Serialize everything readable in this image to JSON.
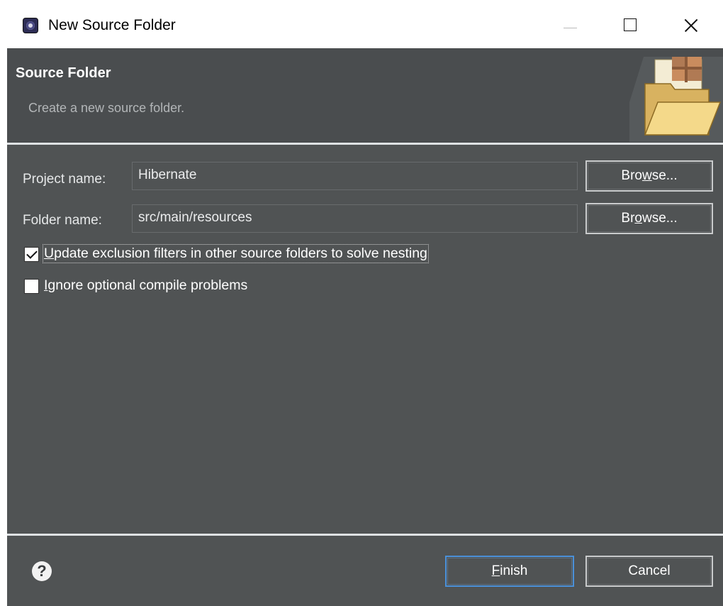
{
  "window": {
    "title": "New Source Folder",
    "icons": {
      "app": "eclipse-app-icon",
      "minimize": "minimize-icon",
      "maximize": "maximize-icon",
      "close": "close-icon"
    }
  },
  "header": {
    "title": "Source Folder",
    "description": "Create a new source folder.",
    "icon": "new-folder-wizard-icon"
  },
  "form": {
    "project_label": "Project name:",
    "project_value": "Hibernate",
    "project_browse_pre": "Bro",
    "project_browse_mn": "w",
    "project_browse_post": "se...",
    "folder_label": "Folder name:",
    "folder_value": "src/main/resources",
    "folder_browse_pre": "Br",
    "folder_browse_mn": "o",
    "folder_browse_post": "wse...",
    "update_exclusion": {
      "mnemonic": "U",
      "rest": "pdate exclusion filters in other source folders to solve nesting",
      "checked": true
    },
    "ignore_optional": {
      "mnemonic": "I",
      "rest": "gnore optional compile problems",
      "checked": false
    }
  },
  "footer": {
    "help_icon": "help-icon",
    "help_glyph": "?",
    "finish_mn": "F",
    "finish_rest": "inish",
    "cancel": "Cancel"
  },
  "colors": {
    "dialog_bg": "#505354",
    "header_bg": "#4a4d4f",
    "separator": "#dfe2e4",
    "default_button_border": "#4a90d9"
  }
}
